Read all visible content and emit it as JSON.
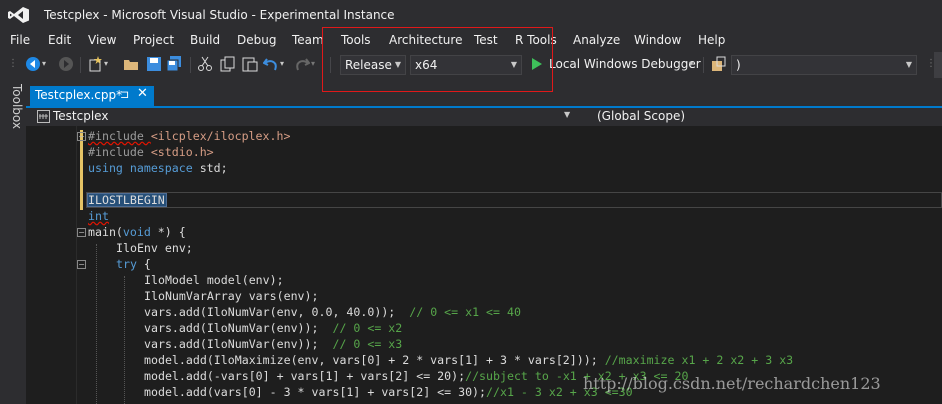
{
  "window": {
    "title": "Testcplex - Microsoft Visual Studio  - Experimental Instance"
  },
  "menu": [
    "File",
    "Edit",
    "View",
    "Project",
    "Build",
    "Debug",
    "Team",
    "Tools",
    "Architecture",
    "Test",
    "R Tools",
    "Analyze",
    "Window",
    "Help"
  ],
  "toolbar": {
    "configuration": "Release",
    "platform": "x64",
    "debugger_label": "Local Windows Debugger",
    "extra_combo": ")"
  },
  "toolbox": {
    "label": "Toolbox"
  },
  "tab": {
    "label": "Testcplex.cpp*",
    "pin": "⊐",
    "close": "✕"
  },
  "navbar": {
    "project": "Testcplex",
    "scope": "(Global Scope)"
  },
  "code": {
    "l1_a": "#include ",
    "l1_b": "<ilcplex/ilocplex.h>",
    "l2_a": "#include ",
    "l2_b": "<stdio.h>",
    "l3_a": "using",
    "l3_b": " namespace",
    "l3_c": " std;",
    "l5": "ILOSTLBEGIN",
    "l6": "int",
    "l7_a": "main(",
    "l7_b": "void",
    "l7_c": " *) {",
    "l8": "IloEnv env;",
    "l9_a": "try",
    "l9_b": " {",
    "l10": "IloModel model(env);",
    "l11": "IloNumVarArray vars(env);",
    "l12_a": "vars.add(IloNumVar(env, 0.0, 40.0));  ",
    "l12_b": "// 0 <= x1 <= 40",
    "l13_a": "vars.add(IloNumVar(env));  ",
    "l13_b": "// 0 <= x2",
    "l14_a": "vars.add(IloNumVar(env));  ",
    "l14_b": "// 0 <= x3",
    "l15_a": "model.add(IloMaximize(env, vars[0] + 2 * vars[1] + 3 * vars[2])); ",
    "l15_b": "//maximize x1 + 2 x2 + 3 x3",
    "l16_a": "model.add(-vars[0] + vars[1] + vars[2] <= 20);",
    "l16_b": "//subject to -x1 + x2 + x3 <= 20",
    "l17_a": "model.add(vars[0] - 3 * vars[1] + vars[2] <= 30);",
    "l17_b": "//x1 - 3 x2 + x3 <=30"
  },
  "watermark": "http://blog.csdn.net/rechardchen123",
  "colors": {
    "accent": "#007acc",
    "highlight_box": "#e0191a",
    "keyword": "#569cd6",
    "comment": "#57a64a",
    "string": "#d69d85"
  }
}
